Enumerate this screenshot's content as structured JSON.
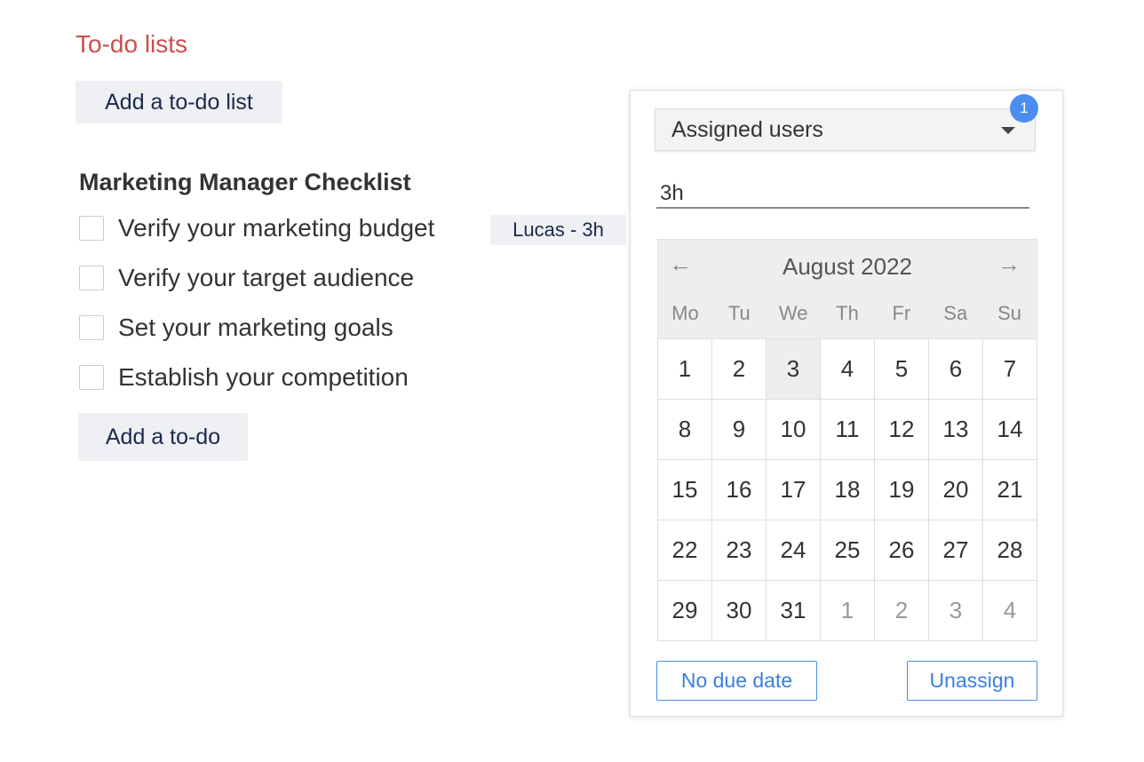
{
  "page": {
    "title": "To-do lists",
    "add_list_label": "Add a to-do list"
  },
  "checklist": {
    "title": "Marketing Manager Checklist",
    "items": [
      {
        "label": "Verify your marketing budget",
        "checked": false,
        "tag": "Lucas - 3h"
      },
      {
        "label": "Verify your target audience",
        "checked": false
      },
      {
        "label": "Set your marketing goals",
        "checked": false
      },
      {
        "label": "Establish your competition",
        "checked": false
      }
    ],
    "add_todo_label": "Add a to-do"
  },
  "popup": {
    "select_value": "Assigned users",
    "badge_count": "1",
    "estimate_value": "3h",
    "calendar": {
      "month": "August 2022",
      "prev_icon": "arrow-left-icon",
      "next_icon": "arrow-right-icon",
      "weekdays": [
        "Mo",
        "Tu",
        "We",
        "Th",
        "Fr",
        "Sa",
        "Su"
      ],
      "days": [
        {
          "d": "1"
        },
        {
          "d": "2"
        },
        {
          "d": "3",
          "selected": true
        },
        {
          "d": "4"
        },
        {
          "d": "5"
        },
        {
          "d": "6"
        },
        {
          "d": "7"
        },
        {
          "d": "8"
        },
        {
          "d": "9"
        },
        {
          "d": "10"
        },
        {
          "d": "11"
        },
        {
          "d": "12"
        },
        {
          "d": "13"
        },
        {
          "d": "14"
        },
        {
          "d": "15"
        },
        {
          "d": "16"
        },
        {
          "d": "17"
        },
        {
          "d": "18"
        },
        {
          "d": "19"
        },
        {
          "d": "20"
        },
        {
          "d": "21"
        },
        {
          "d": "22"
        },
        {
          "d": "23"
        },
        {
          "d": "24"
        },
        {
          "d": "25"
        },
        {
          "d": "26"
        },
        {
          "d": "27"
        },
        {
          "d": "28"
        },
        {
          "d": "29"
        },
        {
          "d": "30"
        },
        {
          "d": "31"
        },
        {
          "d": "1",
          "muted": true
        },
        {
          "d": "2",
          "muted": true
        },
        {
          "d": "3",
          "muted": true
        },
        {
          "d": "4",
          "muted": true
        }
      ]
    },
    "no_due_date_label": "No due date",
    "unassign_label": "Unassign"
  },
  "colors": {
    "title": "#c9504a",
    "accent": "#4a8ef0"
  }
}
